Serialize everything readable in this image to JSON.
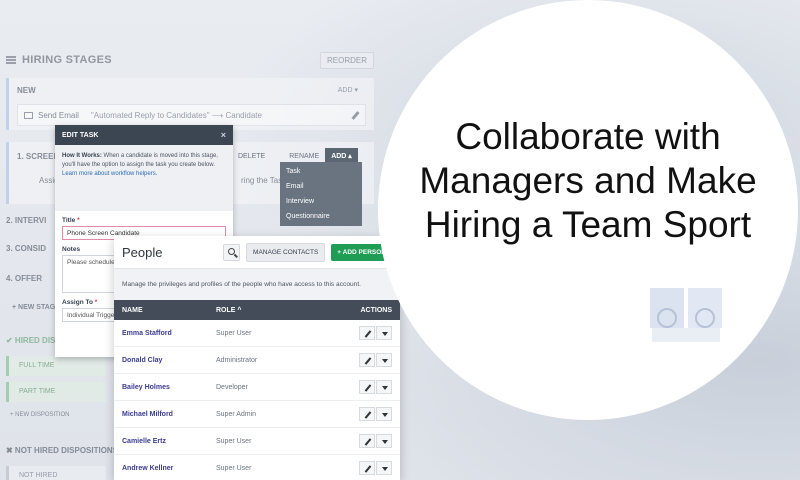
{
  "headline": "Collaborate with Managers and Make Hiring a Team Sport",
  "stages": {
    "title": "HIRING STAGES",
    "reorder_label": "REORDER",
    "new_label": "NEW",
    "add_label": "ADD ▾",
    "send_email_label": "Send Email",
    "send_email_detail": "\"Automated Reply to Candidates\" ⟶ Candidate",
    "screen_label": "1. SCREEN",
    "assign_text": "Assig",
    "during_task": "ring the Task",
    "interview_label": "2. INTERVI",
    "consider_label": "3. CONSID",
    "offer_label": "4. OFFER",
    "new_stage": "+ NEW STAGE",
    "hired_label": "✔ HIRED DISP",
    "full_time": "FULL TIME",
    "part_time": "PART TIME",
    "new_disposition": "+ NEW DISPOSITION",
    "not_hired_label": "✖ NOT HIRED DISPOSITIONS",
    "not_hired_item": "NOT HIRED"
  },
  "stage_actions": {
    "delete": "DELETE",
    "rename": "RENAME",
    "add": "ADD ▴"
  },
  "dropdown": [
    "Task",
    "Email",
    "Interview",
    "Questionnaire"
  ],
  "edit_task": {
    "title": "EDIT TASK",
    "close": "×",
    "how_bold": "How It Works:",
    "how_text": " When a candidate is moved into this stage, you'll have the option to assign the task you create below.",
    "how_link": "Learn more about workflow helpers.",
    "title_label": "Title",
    "title_value": "Phone Screen Candidate",
    "notes_label": "Notes",
    "notes_value": "Please schedule a",
    "assign_label": "Assign To",
    "assign_value": "Individual Trigger"
  },
  "people": {
    "title": "People",
    "manage_label": "MANAGE CONTACTS",
    "add_label": "+ ADD PERSON",
    "description": "Manage the privileges and profiles of the people who have access to this account.",
    "columns": {
      "name": "NAME",
      "role": "ROLE ^",
      "actions": "ACTIONS"
    },
    "rows": [
      {
        "name": "Emma Stafford",
        "role": "Super User"
      },
      {
        "name": "Donald Clay",
        "role": "Administrator"
      },
      {
        "name": "Bailey Holmes",
        "role": "Developer"
      },
      {
        "name": "Michael Milford",
        "role": "Super Admin"
      },
      {
        "name": "Camielle Ertz",
        "role": "Super User"
      },
      {
        "name": "Andrew Kellner",
        "role": "Super User"
      }
    ]
  },
  "colors": {
    "accent_green": "#1f9d55",
    "header_dark": "#434c58",
    "name_link": "#3b3b8f"
  }
}
